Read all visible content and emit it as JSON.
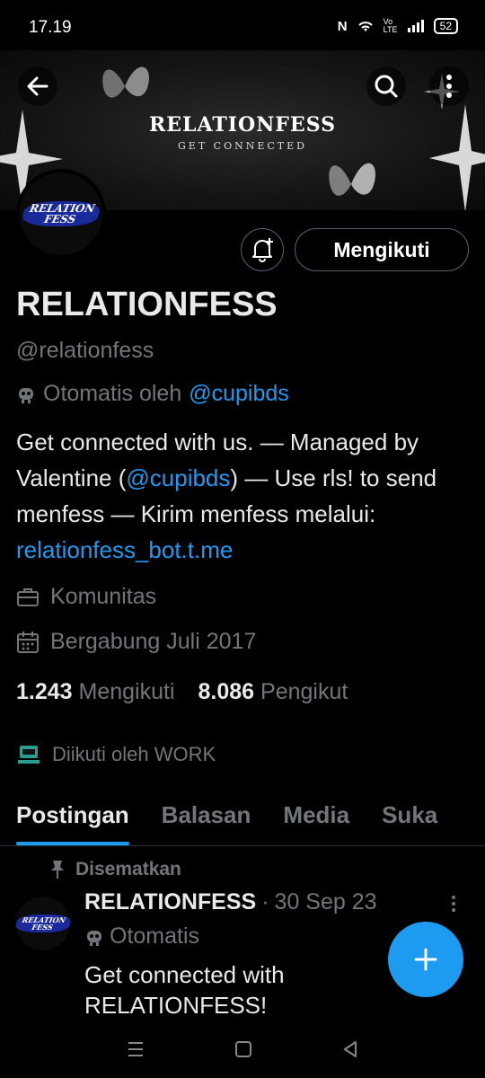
{
  "status_bar": {
    "time": "17.19",
    "battery": "52",
    "network": "Vo LTE"
  },
  "banner": {
    "title": "RELATIONFESS",
    "subtitle": "GET CONNECTED"
  },
  "profile": {
    "avatar_text_line1": "RELATION",
    "avatar_text_line2": "FESS",
    "follow_label": "Mengikuti",
    "display_name": "RELATIONFESS",
    "handle": "@relationfess",
    "automated_prefix": "Otomatis oleh",
    "automated_by": "@cupibds",
    "bio_part1": "Get connected with us. — Managed by Valentine (",
    "bio_mention": "@cupibds",
    "bio_part2": ") — Use rls! to send menfess — Kirim menfess melalui: ",
    "bio_link": "relationfess_bot.t.me",
    "category": "Komunitas",
    "joined": "Bergabung Juli 2017",
    "following_count": "1.243",
    "following_label": "Mengikuti",
    "followers_count": "8.086",
    "followers_label": "Pengikut",
    "followed_by": "Diikuti oleh WORK"
  },
  "tabs": [
    {
      "label": "Postingan",
      "active": true
    },
    {
      "label": "Balasan",
      "active": false
    },
    {
      "label": "Media",
      "active": false
    },
    {
      "label": "Suka",
      "active": false
    }
  ],
  "pinned_post": {
    "pinned_label": "Disematkan",
    "author": "RELATIONFESS",
    "separator": "·",
    "date": "30 Sep 23",
    "automated": "Otomatis",
    "text": "Get connected with RELATIONFESS!",
    "avatar_text_line1": "RELATION",
    "avatar_text_line2": "FESS"
  },
  "icons": {
    "back": "arrow-left-icon",
    "search": "search-icon",
    "more": "more-vertical-icon",
    "bell": "bell-plus-icon",
    "robot": "robot-icon",
    "briefcase": "briefcase-icon",
    "calendar": "calendar-icon",
    "pin": "pin-icon",
    "fab": "plus-icon"
  },
  "colors": {
    "accent": "#1d9bf0",
    "muted": "#71767b",
    "text": "#e7e9ea",
    "background": "#000000"
  }
}
